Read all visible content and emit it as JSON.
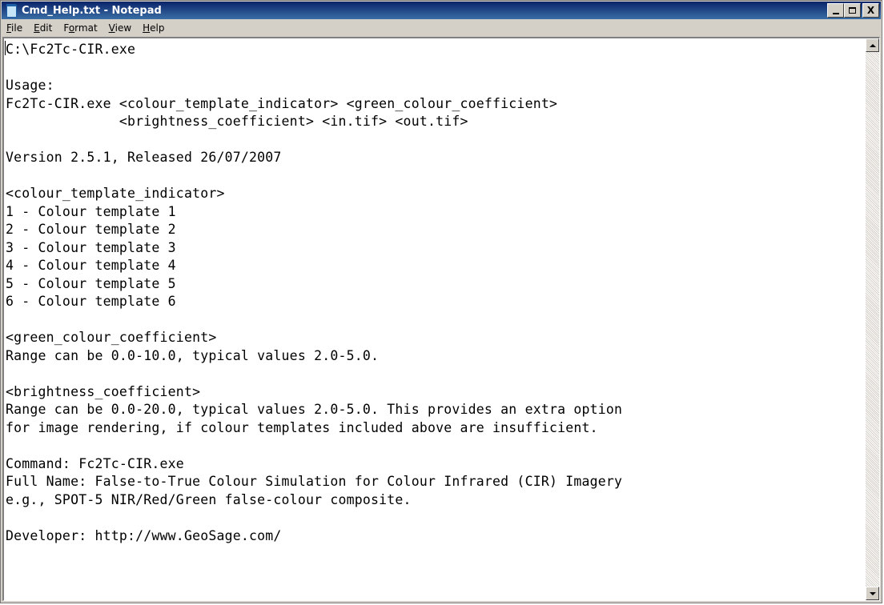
{
  "window": {
    "title": "Cmd_Help.txt - Notepad",
    "app_icon": "notepad-icon",
    "controls": {
      "minimize": "minimize-icon",
      "maximize": "maximize-icon",
      "close_label": "X"
    }
  },
  "menubar": {
    "items": [
      {
        "accel": "F",
        "rest": "ile"
      },
      {
        "accel": "E",
        "rest": "dit"
      },
      {
        "accel": "o",
        "before": "F",
        "rest": "rmat"
      },
      {
        "accel": "V",
        "rest": "iew"
      },
      {
        "accel": "H",
        "rest": "elp"
      }
    ]
  },
  "document": {
    "lines": [
      "C:\\Fc2Tc-CIR.exe",
      "",
      "Usage:",
      "Fc2Tc-CIR.exe <colour_template_indicator> <green_colour_coefficient>",
      "              <brightness_coefficient> <in.tif> <out.tif>",
      "",
      "Version 2.5.1, Released 26/07/2007",
      "",
      "<colour_template_indicator>",
      "1 - Colour template 1",
      "2 - Colour template 2",
      "3 - Colour template 3",
      "4 - Colour template 4",
      "5 - Colour template 5",
      "6 - Colour template 6",
      "",
      "<green_colour_coefficient>",
      "Range can be 0.0-10.0, typical values 2.0-5.0.",
      "",
      "<brightness_coefficient>",
      "Range can be 0.0-20.0, typical values 2.0-5.0. This provides an extra option",
      "for image rendering, if colour templates included above are insufficient.",
      "",
      "Command: Fc2Tc-CIR.exe",
      "Full Name: False-to-True Colour Simulation for Colour Infrared (CIR) Imagery",
      "e.g., SPOT-5 NIR/Red/Green false-colour composite.",
      "",
      "Developer: http://www.GeoSage.com/"
    ]
  },
  "scrollbar": {
    "up_icon": "scroll-up-arrow-icon",
    "down_icon": "scroll-down-arrow-icon"
  }
}
